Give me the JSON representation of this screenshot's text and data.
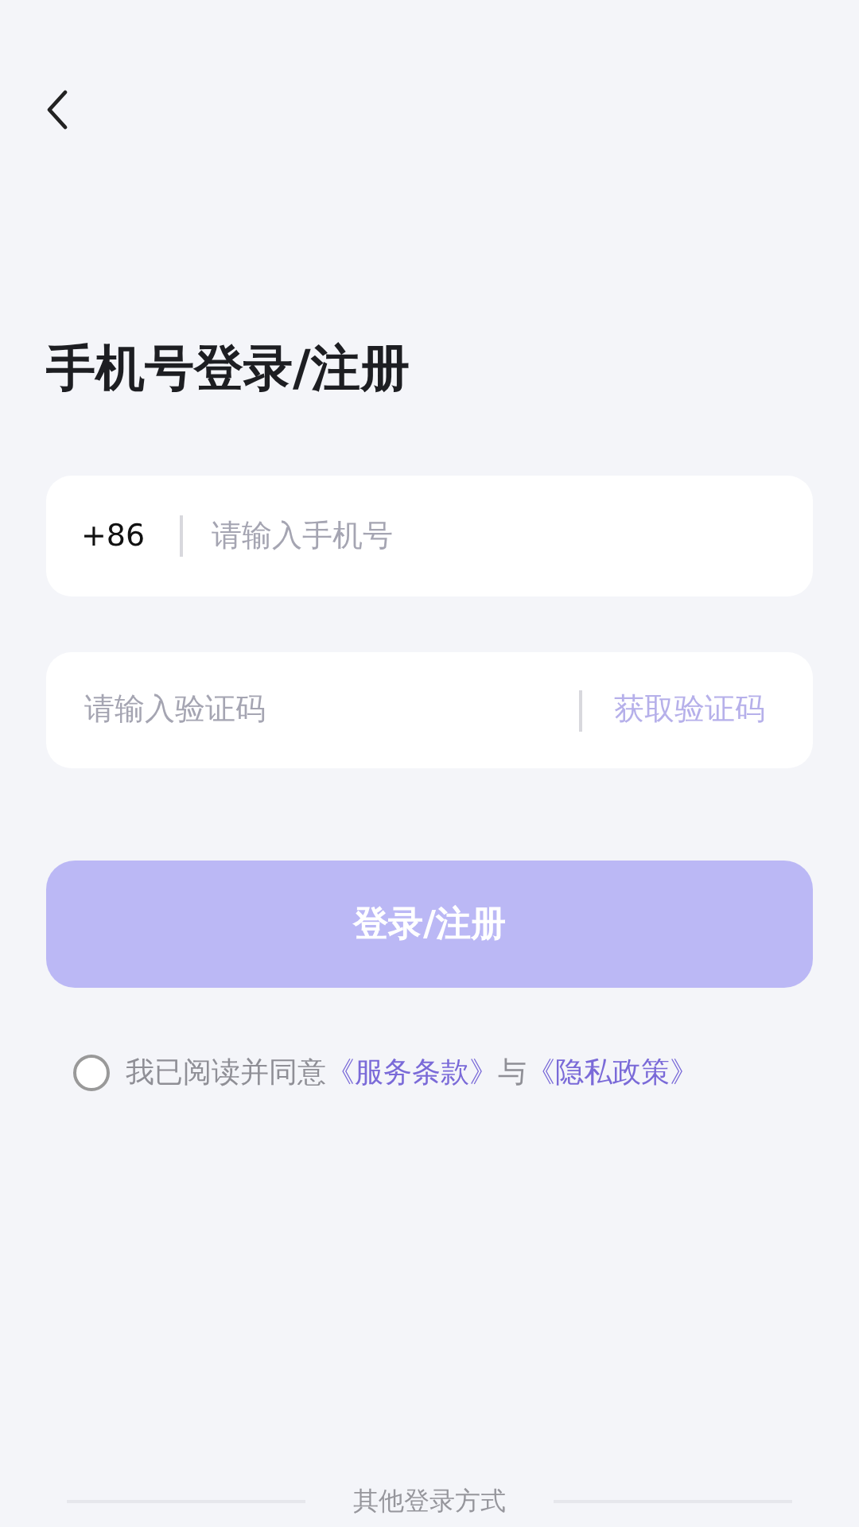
{
  "title": "手机号登录/注册",
  "phone_field": {
    "country_code": "+86",
    "placeholder": "请输入手机号"
  },
  "code_field": {
    "placeholder": "请输入验证码",
    "action": "获取验证码"
  },
  "submit_button": {
    "label": "登录/注册",
    "disabled": true
  },
  "agreement": {
    "checked": false,
    "text": "我已阅读并同意",
    "terms_link": "《服务条款》",
    "joiner": "与",
    "privacy_link": "《隐私政策》"
  },
  "other_login": {
    "label": "其他登录方式"
  }
}
